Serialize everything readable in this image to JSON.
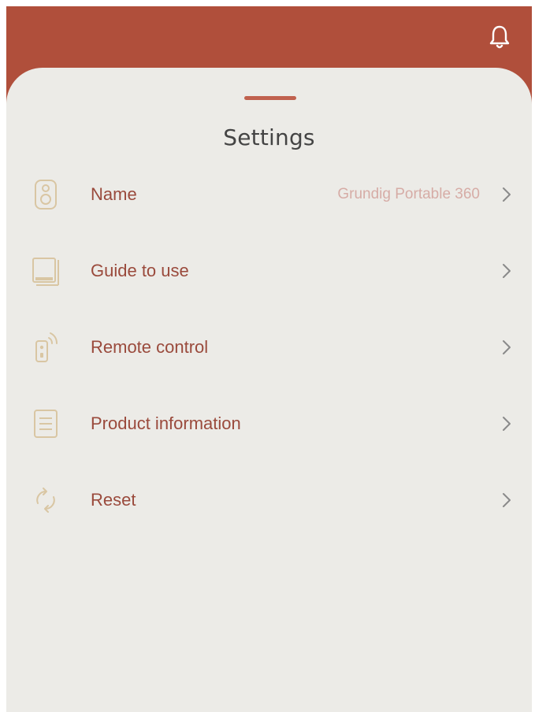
{
  "header": {
    "icon": "bell-icon",
    "color": "#b04f3b"
  },
  "sheet": {
    "title": "Settings"
  },
  "settings": {
    "items": [
      {
        "icon": "speaker-icon",
        "label": "Name",
        "value": "Grundig Portable 360"
      },
      {
        "icon": "book-icon",
        "label": "Guide to use"
      },
      {
        "icon": "remote-control-icon",
        "label": "Remote control"
      },
      {
        "icon": "document-icon",
        "label": "Product information"
      },
      {
        "icon": "reset-icon",
        "label": "Reset"
      }
    ]
  },
  "colors": {
    "accent": "#b04f3b",
    "label": "#9a4a3c",
    "value": "#d6aca6",
    "icon_stroke": "#d9c6a3",
    "background": "#ecebe7"
  }
}
